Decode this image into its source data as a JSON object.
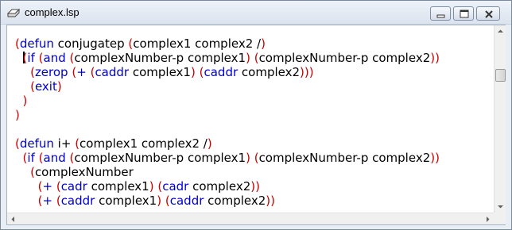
{
  "window": {
    "title": "complex.lsp",
    "icon": "document-icon"
  },
  "editor": {
    "lines": [
      [
        {
          "t": "(",
          "c": "p"
        },
        {
          "t": "defun",
          "c": "k"
        },
        {
          "t": " conjugatep "
        },
        {
          "t": "(",
          "c": "p"
        },
        {
          "t": "complex1 complex2 /"
        },
        {
          "t": ")",
          "c": "p"
        }
      ],
      [
        {
          "t": "  "
        },
        {
          "cursor": true
        },
        {
          "t": "(",
          "c": "p"
        },
        {
          "t": "if",
          "c": "k"
        },
        {
          "t": " "
        },
        {
          "t": "(",
          "c": "p"
        },
        {
          "t": "and",
          "c": "k"
        },
        {
          "t": " "
        },
        {
          "t": "(",
          "c": "p"
        },
        {
          "t": "complexNumber-p complex1"
        },
        {
          "t": ")",
          "c": "p"
        },
        {
          "t": " "
        },
        {
          "t": "(",
          "c": "p"
        },
        {
          "t": "complexNumber-p complex2"
        },
        {
          "t": "))",
          "c": "p"
        }
      ],
      [
        {
          "t": "    "
        },
        {
          "t": "(",
          "c": "p"
        },
        {
          "t": "zerop",
          "c": "k"
        },
        {
          "t": " "
        },
        {
          "t": "(",
          "c": "p"
        },
        {
          "t": "+",
          "c": "k"
        },
        {
          "t": " "
        },
        {
          "t": "(",
          "c": "p"
        },
        {
          "t": "caddr",
          "c": "k"
        },
        {
          "t": " complex1"
        },
        {
          "t": ")",
          "c": "p"
        },
        {
          "t": " "
        },
        {
          "t": "(",
          "c": "p"
        },
        {
          "t": "caddr",
          "c": "k"
        },
        {
          "t": " complex2"
        },
        {
          "t": ")))",
          "c": "p"
        }
      ],
      [
        {
          "t": "    "
        },
        {
          "t": "(",
          "c": "p"
        },
        {
          "t": "exit",
          "c": "k"
        },
        {
          "t": ")",
          "c": "p"
        }
      ],
      [
        {
          "t": "  "
        },
        {
          "t": ")",
          "c": "p"
        }
      ],
      [
        {
          "t": ")",
          "c": "p"
        }
      ],
      [],
      [
        {
          "t": "(",
          "c": "p"
        },
        {
          "t": "defun",
          "c": "k"
        },
        {
          "t": " i+ "
        },
        {
          "t": "(",
          "c": "p"
        },
        {
          "t": "complex1 complex2 /"
        },
        {
          "t": ")",
          "c": "p"
        }
      ],
      [
        {
          "t": "  "
        },
        {
          "t": "(",
          "c": "p"
        },
        {
          "t": "if",
          "c": "k"
        },
        {
          "t": " "
        },
        {
          "t": "(",
          "c": "p"
        },
        {
          "t": "and",
          "c": "k"
        },
        {
          "t": " "
        },
        {
          "t": "(",
          "c": "p"
        },
        {
          "t": "complexNumber-p complex1"
        },
        {
          "t": ")",
          "c": "p"
        },
        {
          "t": " "
        },
        {
          "t": "(",
          "c": "p"
        },
        {
          "t": "complexNumber-p complex2"
        },
        {
          "t": "))",
          "c": "p"
        }
      ],
      [
        {
          "t": "    "
        },
        {
          "t": "(",
          "c": "p"
        },
        {
          "t": "complexNumber"
        }
      ],
      [
        {
          "t": "      "
        },
        {
          "t": "(",
          "c": "p"
        },
        {
          "t": "+",
          "c": "k"
        },
        {
          "t": " "
        },
        {
          "t": "(",
          "c": "p"
        },
        {
          "t": "cadr",
          "c": "k"
        },
        {
          "t": " complex1"
        },
        {
          "t": ")",
          "c": "p"
        },
        {
          "t": " "
        },
        {
          "t": "(",
          "c": "p"
        },
        {
          "t": "cadr",
          "c": "k"
        },
        {
          "t": " complex2"
        },
        {
          "t": "))",
          "c": "p"
        }
      ],
      [
        {
          "t": "      "
        },
        {
          "t": "(",
          "c": "p"
        },
        {
          "t": "+",
          "c": "k"
        },
        {
          "t": " "
        },
        {
          "t": "(",
          "c": "p"
        },
        {
          "t": "caddr",
          "c": "k"
        },
        {
          "t": " complex1"
        },
        {
          "t": ")",
          "c": "p"
        },
        {
          "t": " "
        },
        {
          "t": "(",
          "c": "p"
        },
        {
          "t": "caddr",
          "c": "k"
        },
        {
          "t": " complex2"
        },
        {
          "t": "))",
          "c": "p"
        }
      ],
      [
        {
          "t": "    "
        },
        {
          "t": ")",
          "c": "p"
        }
      ]
    ]
  },
  "colors": {
    "paren": "#cc0000",
    "keyword": "#0000cc",
    "text": "#000000"
  },
  "scrollbars": {
    "vertical_position": 0.18,
    "horizontal_position": 0
  }
}
